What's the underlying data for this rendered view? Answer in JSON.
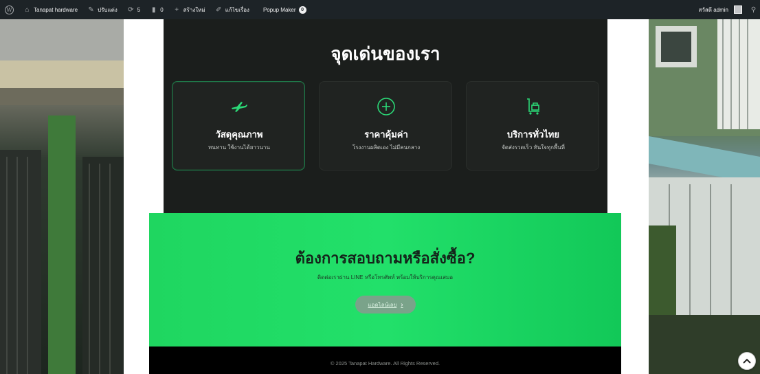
{
  "adminbar": {
    "site_name": "Tanapat hardware",
    "customize": "ปรับแต่ง",
    "updates_count": "5",
    "comments_count": "0",
    "new_label": "สร้างใหม่",
    "edit_label": "แก้ไขเรื่อง",
    "popup_maker": "Popup Maker",
    "popup_badge": "0",
    "greeting": "สวัสดี admin"
  },
  "features": {
    "title": "จุดเด่นของเรา",
    "cards": [
      {
        "title": "วัสดุคุณภาพ",
        "desc": "ทนทาน ใช้งานได้ยาวนาน",
        "icon": "plane-icon"
      },
      {
        "title": "ราคาคุ้มค่า",
        "desc": "โรงงานผลิตเอง ไม่มีคนกลาง",
        "icon": "plus-circle-icon"
      },
      {
        "title": "บริการทั่วไทย",
        "desc": "จัดส่งรวดเร็ว ทันใจทุกพื้นที่",
        "icon": "trolley-icon"
      }
    ]
  },
  "cta": {
    "title": "ต้องการสอบถามหรือสั่งซื้อ?",
    "subtitle": "ติดต่อเราผ่าน LINE หรือโทรศัพท์ พร้อมให้บริการคุณเสมอ",
    "button_label": "แอดไลน์เลย",
    "button_icon": "chevron-right-icon"
  },
  "footer": {
    "copyright": "© 2025 Tanapat Hardware. All Rights Reserved."
  },
  "colors": {
    "accent_green": "#22e06a",
    "icon_green": "#2bd977",
    "dark_bg": "#1b1e1c",
    "adminbar_bg": "#1d2327"
  }
}
